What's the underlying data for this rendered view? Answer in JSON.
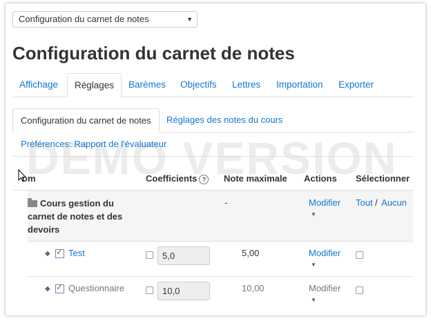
{
  "page_select": {
    "value": "Configuration du carnet de notes"
  },
  "title": "Configuration du carnet de notes",
  "tabs": [
    {
      "label": "Affichage"
    },
    {
      "label": "Réglages"
    },
    {
      "label": "Barèmes"
    },
    {
      "label": "Objectifs"
    },
    {
      "label": "Lettres"
    },
    {
      "label": "Importation"
    },
    {
      "label": "Exporter"
    }
  ],
  "subtabs": [
    {
      "label": "Configuration du carnet de notes"
    },
    {
      "label": "Réglages des notes du cours"
    }
  ],
  "preferences_link": "Préférences: Rapport de l'évaluateur",
  "watermark": "DEMO VERSION",
  "table": {
    "headers": {
      "name": "om",
      "coefficients": "Coefficients",
      "max": "Note maximale",
      "actions": "Actions",
      "select": "Sélectionner"
    },
    "category": {
      "name": "Cours gestion du carnet de notes et des devoirs",
      "max": "-",
      "action": "Modifier",
      "select_all": "Tout",
      "select_sep": "/",
      "select_none": "Aucun"
    },
    "items": [
      {
        "name": "Test",
        "coefficient": "5,0",
        "max": "5,00",
        "action": "Modifier"
      },
      {
        "name": "Questionnaire",
        "coefficient": "10,0",
        "max": "10,00",
        "action": "Modifier"
      }
    ]
  }
}
